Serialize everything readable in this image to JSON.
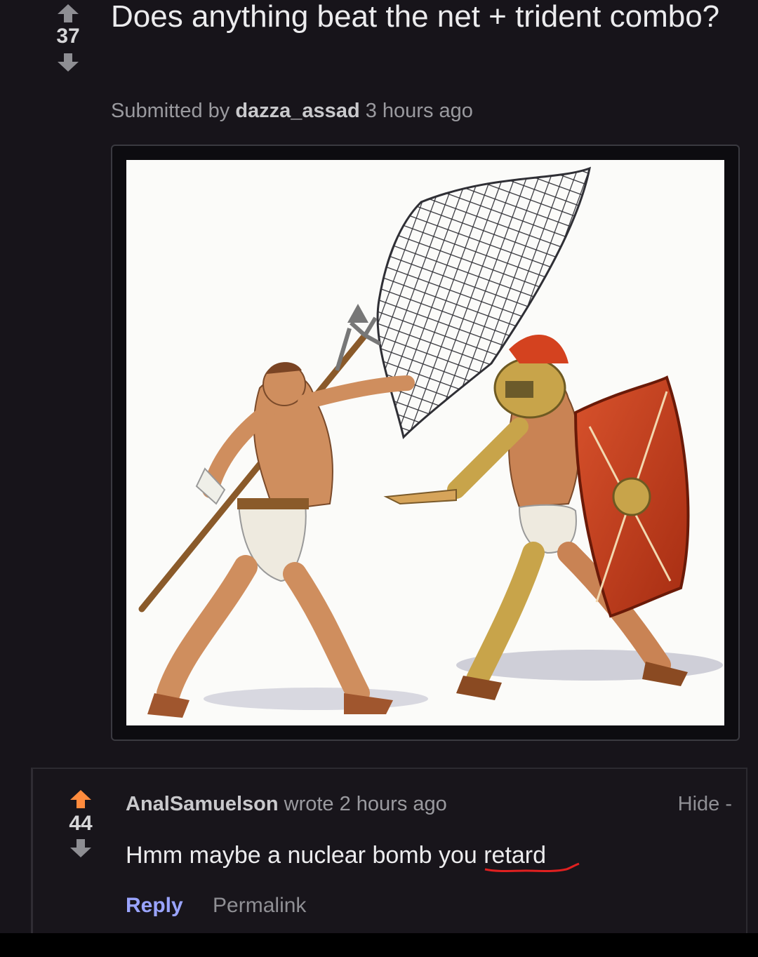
{
  "post": {
    "score": "37",
    "title": "Does anything beat the net + trident combo?",
    "submitted_prefix": "Submitted by",
    "author": "dazza_assad",
    "time": "3 hours ago",
    "image": {
      "kind": "illustration",
      "subject": "gladiators"
    }
  },
  "comment": {
    "score": "44",
    "author": "AnalSamuelson",
    "wrote_text": "wrote 2 hours ago",
    "hide_label": "Hide -",
    "body_main": "Hmm maybe a nuclear bomb you ",
    "body_last": "retard",
    "reply_label": "Reply",
    "permalink_label": "Permalink"
  },
  "colors": {
    "background": "#17141a",
    "upvote_active": "#ff8b3d",
    "link": "#9aa4ff",
    "squiggle": "#e02020"
  }
}
